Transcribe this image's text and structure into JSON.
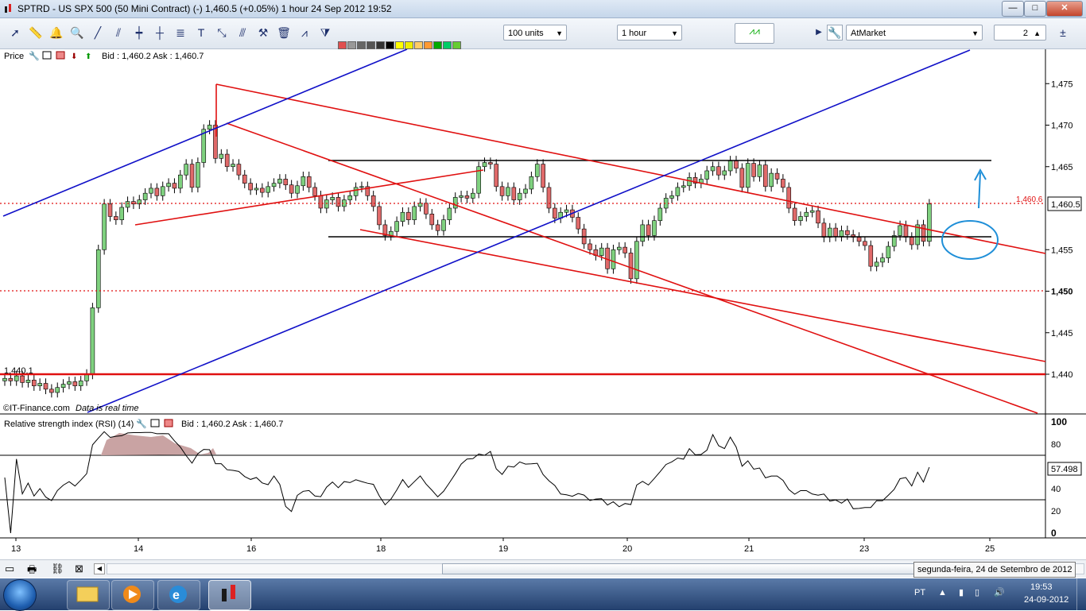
{
  "window": {
    "title": "SPTRD - US SPX 500 (50 Mini Contract) (-)    1,460.5 (+0.05%)     1 hour  24 Sep 2012 19:52",
    "controls": [
      "—",
      "□",
      "✕"
    ]
  },
  "toolbar": {
    "units_select": "100 units",
    "timeframe_select": "1 hour",
    "order_type_select": "AtMarket",
    "quantity_value": "2"
  },
  "price_panel": {
    "label": "Price",
    "bid_ask": "Bid : 1,460.2  Ask : 1,460.7",
    "current_price_tag": "1,460.5",
    "red_dotted_label": "1,460.6",
    "left_level_label": "1,440.1",
    "copyright": "©IT-Finance.com",
    "realtime_note": "Data is real time",
    "y_ticks": [
      "1,475",
      "1,470",
      "1,465",
      "1,455",
      "1,450",
      "1,445",
      "1,440"
    ],
    "colors": {
      "up_candle": "#7fd17f",
      "down_candle": "#e06a6a",
      "trend_red": "#e01010",
      "trend_blue": "#1010c8",
      "level_black": "#000000"
    }
  },
  "rsi_panel": {
    "label": "Relative strength index (RSI) (14)",
    "bid_ask": "Bid : 1,460.2  Ask : 1,460.7",
    "value_tag": "57.498",
    "y_ticks": [
      "100",
      "80",
      "40",
      "20",
      "0"
    ]
  },
  "x_axis": {
    "labels": [
      "13",
      "14",
      "16",
      "18",
      "19",
      "20",
      "21",
      "23",
      "25"
    ]
  },
  "tooltip": "segunda-feira, 24 de Setembro de 2012",
  "taskbar": {
    "language": "PT",
    "time": "19:53",
    "date": "24-09-2012"
  },
  "chart_data": {
    "type": "candlestick",
    "instrument": "SPTRD - US SPX 500 (50 Mini Contract)",
    "timeframe": "1 hour",
    "ylim": [
      1437,
      1479
    ],
    "x_labels": [
      "13",
      "14",
      "16",
      "18",
      "19",
      "20",
      "21",
      "23",
      "25"
    ],
    "close_series": [
      1439.5,
      1439.2,
      1439.8,
      1439.0,
      1439.3,
      1438.6,
      1438.9,
      1438.2,
      1437.8,
      1438.4,
      1438.8,
      1439.1,
      1438.6,
      1439.2,
      1440.0,
      1448.0,
      1455.0,
      1460.5,
      1459.0,
      1458.6,
      1460.1,
      1460.8,
      1460.5,
      1461.0,
      1461.8,
      1462.4,
      1461.5,
      1462.6,
      1463.0,
      1462.4,
      1464.0,
      1465.3,
      1462.5,
      1465.5,
      1469.5,
      1470.0,
      1466.0,
      1466.5,
      1465.0,
      1465.3,
      1464.0,
      1463.0,
      1462.2,
      1462.4,
      1461.9,
      1462.6,
      1463.0,
      1463.5,
      1462.8,
      1461.8,
      1462.7,
      1463.8,
      1462.5,
      1461.5,
      1460.0,
      1461.0,
      1461.3,
      1460.2,
      1461.0,
      1461.5,
      1462.5,
      1462.6,
      1461.5,
      1460.2,
      1458.0,
      1456.7,
      1457.2,
      1458.4,
      1459.5,
      1458.6,
      1460.2,
      1460.6,
      1459.3,
      1458.0,
      1457.3,
      1458.6,
      1460.0,
      1461.3,
      1461.5,
      1461.2,
      1461.8,
      1465.0,
      1465.5,
      1465.3,
      1462.6,
      1461.5,
      1462.5,
      1461.0,
      1461.8,
      1462.3,
      1463.8,
      1465.3,
      1462.5,
      1460.0,
      1458.8,
      1459.5,
      1459.8,
      1458.9,
      1457.5,
      1455.7,
      1455.0,
      1454.3,
      1455.2,
      1452.7,
      1455.0,
      1455.3,
      1454.6,
      1451.5,
      1456.0,
      1458.0,
      1456.7,
      1458.5,
      1460.0,
      1461.2,
      1461.5,
      1462.5,
      1462.7,
      1463.7,
      1463.0,
      1463.5,
      1464.5,
      1465.0,
      1464.0,
      1464.5,
      1465.7,
      1464.8,
      1462.5,
      1465.4,
      1463.8,
      1465.2,
      1462.6,
      1464.2,
      1463.5,
      1462.5,
      1460.0,
      1458.5,
      1459.0,
      1459.5,
      1459.7,
      1458.2,
      1456.5,
      1457.6,
      1456.6,
      1457.3,
      1456.8,
      1456.5,
      1456.0,
      1455.5,
      1453.0,
      1453.5,
      1454.0,
      1455.4,
      1456.7,
      1457.9,
      1456.5,
      1455.6,
      1458.0,
      1456.0,
      1460.5
    ]
  }
}
